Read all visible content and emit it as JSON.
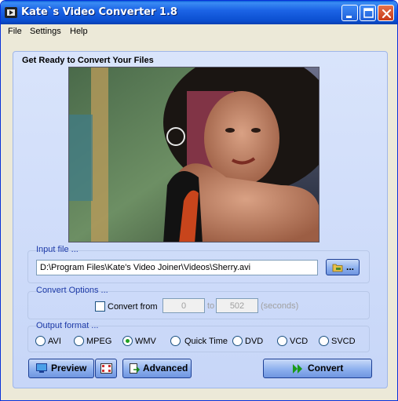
{
  "window": {
    "title": "Kate`s Video Converter 1.8",
    "colors": {
      "titlebar": "#0b4fd0",
      "panel": "#c7d6f8",
      "group_label": "#1d3aa8"
    }
  },
  "menu": {
    "items": [
      "File",
      "Settings",
      "Help"
    ]
  },
  "main": {
    "heading": "Get Ready to Convert Your Files"
  },
  "input_file": {
    "group_label": "Input file ...",
    "value": "D:\\Program Files\\Kate's Video Joiner\\Videos\\Sherry.avi",
    "browse_label": "..."
  },
  "convert_options": {
    "group_label": "Convert Options ...",
    "checkbox_label": "Convert from",
    "checked": false,
    "from_value": "0",
    "to_label": "to",
    "to_value": "502",
    "unit_label": "(seconds)"
  },
  "output_format": {
    "group_label": "Output format ...",
    "options": [
      "AVI",
      "MPEG",
      "WMV",
      "Quick Time",
      "DVD",
      "VCD",
      "SVCD"
    ],
    "selected": "WMV"
  },
  "buttons": {
    "preview": "Preview",
    "advanced": "Advanced",
    "convert": "Convert"
  },
  "icons": {
    "app": "film-reel-icon",
    "preview": "monitor-icon",
    "filmstrip": "filmstrip-icon",
    "advanced": "document-arrow-icon",
    "convert": "double-arrow-icon",
    "browse": "folder-icon"
  }
}
